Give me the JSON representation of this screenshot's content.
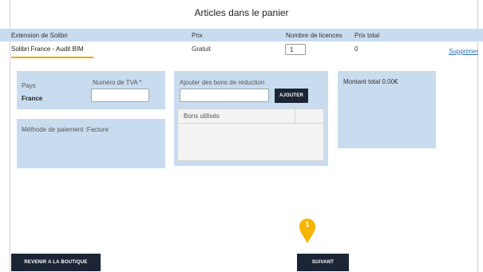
{
  "page": {
    "title": "Articles dans le panier"
  },
  "cart_table": {
    "headers": {
      "extension": "Extension de Solibri",
      "price": "Prix",
      "licenses": "Nombre de licences",
      "total": "Prix total"
    },
    "rows": [
      {
        "name": "Solibri France - Audit BIM",
        "price": "Gratuit",
        "quantity": "1",
        "total": "0",
        "remove_label": "Supprimer"
      }
    ]
  },
  "country_panel": {
    "country_label": "Pays",
    "country_value": "France",
    "vat_label": "Numéro de TVA *",
    "vat_value": ""
  },
  "payment_panel": {
    "label": "Méthode de paiement :Facture"
  },
  "coupon_panel": {
    "label": "Ajouter des bons de réduction",
    "input_value": "",
    "add_button": "AJOUTER",
    "used_header": "Bons utilisés"
  },
  "total_panel": {
    "label": "Montant total 0.00€"
  },
  "footer": {
    "back_button": "REVENIR A LA BOUTIQUE",
    "next_button": "SUIVANT"
  },
  "step_marker": {
    "number": "1",
    "color": "#f5b400"
  },
  "colors": {
    "panel_bg": "#c9dcef",
    "button_bg": "#1c2536",
    "accent_underline": "#f0a500",
    "link": "#2a6fb5"
  }
}
